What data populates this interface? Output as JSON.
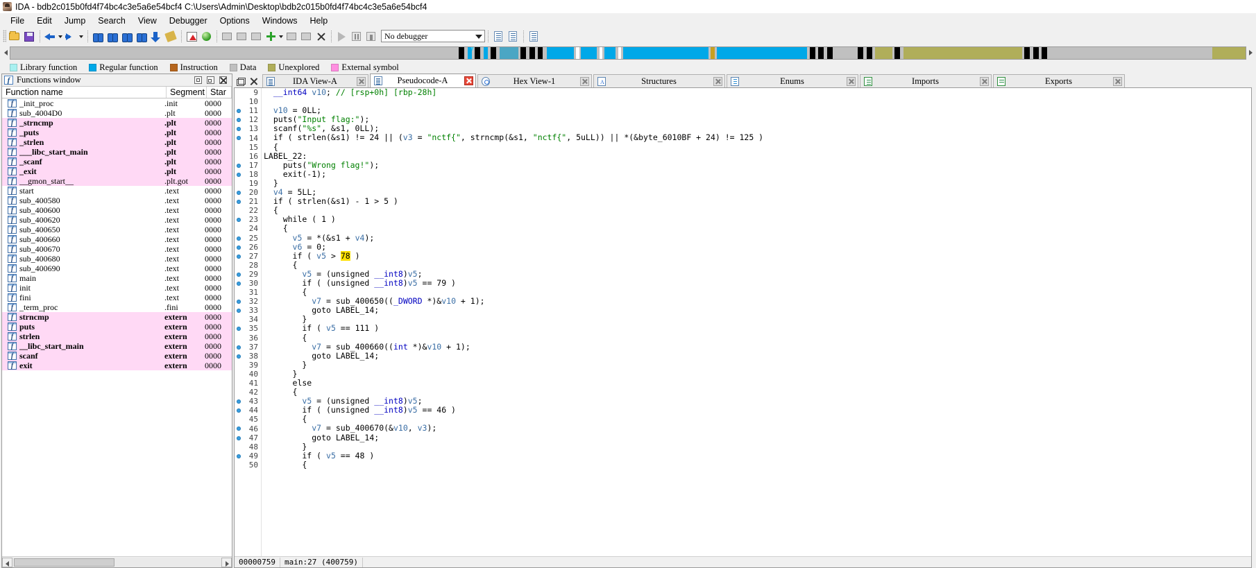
{
  "window": {
    "title": "IDA - bdb2c015b0fd4f74bc4c3e5a6e54bcf4 C:\\Users\\Admin\\Desktop\\bdb2c015b0fd4f74bc4c3e5a6e54bcf4",
    "icon": "ida-logo-icon"
  },
  "menu": {
    "items": [
      "File",
      "Edit",
      "Jump",
      "Search",
      "View",
      "Debugger",
      "Options",
      "Windows",
      "Help"
    ]
  },
  "toolbar": {
    "debugger_select_value": "No debugger",
    "icons": [
      "open-file-icon",
      "save-icon",
      "back-arrow-icon",
      "back-dropdown-icon",
      "forward-arrow-icon",
      "forward-dropdown-icon",
      "search-hash-icon",
      "search-text-icon",
      "search-immediate-icon",
      "search-next-icon",
      "jump-down-icon",
      "edit-function-icon",
      "graph-view-icon",
      "green-ball-icon",
      "make-code-icon",
      "make-data-icon",
      "make-string-icon",
      "add-function-icon",
      "add-function-dropdown-icon",
      "delete-function-icon",
      "undefine-icon",
      "delete-icon",
      "run-icon",
      "pause-icon",
      "stop-icon",
      "step-icon",
      "step-over-icon",
      "breakpoints-icon"
    ]
  },
  "navband": {
    "left_arrow": "nav-scroll-left-icon",
    "right_arrow": "nav-scroll-right-icon",
    "cursor_position_pct": 37.2,
    "segments": [
      {
        "left_pct": 0.0,
        "width_pct": 36.3,
        "color": "#c0c0c0"
      },
      {
        "left_pct": 36.3,
        "width_pct": 0.45,
        "color": "#000000"
      },
      {
        "left_pct": 37.0,
        "width_pct": 0.35,
        "color": "#00a8e8"
      },
      {
        "left_pct": 37.6,
        "width_pct": 0.45,
        "color": "#000000"
      },
      {
        "left_pct": 38.3,
        "width_pct": 0.35,
        "color": "#00a8e8"
      },
      {
        "left_pct": 38.9,
        "width_pct": 0.4,
        "color": "#000000"
      },
      {
        "left_pct": 39.6,
        "width_pct": 1.5,
        "color": "#4ba6c4"
      },
      {
        "left_pct": 41.3,
        "width_pct": 0.45,
        "color": "#000000"
      },
      {
        "left_pct": 42.0,
        "width_pct": 0.45,
        "color": "#000000"
      },
      {
        "left_pct": 42.7,
        "width_pct": 0.4,
        "color": "#000000"
      },
      {
        "left_pct": 43.4,
        "width_pct": 2.2,
        "color": "#00a8e8"
      },
      {
        "left_pct": 45.8,
        "width_pct": 0.25,
        "color": "#ffffff"
      },
      {
        "left_pct": 46.2,
        "width_pct": 1.3,
        "color": "#00a8e8"
      },
      {
        "left_pct": 47.7,
        "width_pct": 0.25,
        "color": "#ffffff"
      },
      {
        "left_pct": 48.1,
        "width_pct": 0.9,
        "color": "#00a8e8"
      },
      {
        "left_pct": 49.2,
        "width_pct": 0.25,
        "color": "#ffffff"
      },
      {
        "left_pct": 49.6,
        "width_pct": 6.9,
        "color": "#00a8e8"
      },
      {
        "left_pct": 56.7,
        "width_pct": 0.3,
        "color": "#c8a020"
      },
      {
        "left_pct": 57.2,
        "width_pct": 7.3,
        "color": "#00a8e8"
      },
      {
        "left_pct": 64.7,
        "width_pct": 0.45,
        "color": "#000000"
      },
      {
        "left_pct": 65.4,
        "width_pct": 0.45,
        "color": "#000000"
      },
      {
        "left_pct": 66.1,
        "width_pct": 0.45,
        "color": "#000000"
      },
      {
        "left_pct": 66.8,
        "width_pct": 1.6,
        "color": "#c0c0c0"
      },
      {
        "left_pct": 68.6,
        "width_pct": 0.45,
        "color": "#000000"
      },
      {
        "left_pct": 69.3,
        "width_pct": 0.45,
        "color": "#000000"
      },
      {
        "left_pct": 70.0,
        "width_pct": 1.4,
        "color": "#b0ae5a"
      },
      {
        "left_pct": 71.6,
        "width_pct": 0.45,
        "color": "#000000"
      },
      {
        "left_pct": 72.3,
        "width_pct": 9.6,
        "color": "#b0ae5a"
      },
      {
        "left_pct": 82.1,
        "width_pct": 0.45,
        "color": "#000000"
      },
      {
        "left_pct": 82.8,
        "width_pct": 0.45,
        "color": "#000000"
      },
      {
        "left_pct": 83.5,
        "width_pct": 0.45,
        "color": "#000000"
      },
      {
        "left_pct": 84.2,
        "width_pct": 12.9,
        "color": "#c0c0c0"
      },
      {
        "left_pct": 97.3,
        "width_pct": 2.7,
        "color": "#b0ae5a"
      }
    ]
  },
  "legend": {
    "items": [
      {
        "label": "Library function",
        "color": "#a8f0f0"
      },
      {
        "label": "Regular function",
        "color": "#00a8e8"
      },
      {
        "label": "Instruction",
        "color": "#b5651d"
      },
      {
        "label": "Data",
        "color": "#c0c0c0"
      },
      {
        "label": "Unexplored",
        "color": "#b0ae5a"
      },
      {
        "label": "External symbol",
        "color": "#ff8fe0"
      }
    ]
  },
  "functions_window": {
    "title": "Functions window",
    "title_icon": "function-f-icon",
    "window_buttons": [
      "dock-icon",
      "maximize-icon",
      "restore-icon",
      "close-icon"
    ],
    "columns": [
      "Function name",
      "Segment",
      "Star"
    ],
    "rows": [
      {
        "name": "_init_proc",
        "segment": ".init",
        "start": "0000",
        "pink": false,
        "bold": false
      },
      {
        "name": "sub_4004D0",
        "segment": ".plt",
        "start": "0000",
        "pink": false,
        "bold": false
      },
      {
        "name": "_strncmp",
        "segment": ".plt",
        "start": "0000",
        "pink": true,
        "bold": true
      },
      {
        "name": "_puts",
        "segment": ".plt",
        "start": "0000",
        "pink": true,
        "bold": true
      },
      {
        "name": "_strlen",
        "segment": ".plt",
        "start": "0000",
        "pink": true,
        "bold": true
      },
      {
        "name": "___libc_start_main",
        "segment": ".plt",
        "start": "0000",
        "pink": true,
        "bold": true
      },
      {
        "name": "_scanf",
        "segment": ".plt",
        "start": "0000",
        "pink": true,
        "bold": true
      },
      {
        "name": "_exit",
        "segment": ".plt",
        "start": "0000",
        "pink": true,
        "bold": true
      },
      {
        "name": "__gmon_start__",
        "segment": ".plt.got",
        "start": "0000",
        "pink": true,
        "bold": false
      },
      {
        "name": "start",
        "segment": ".text",
        "start": "0000",
        "pink": false,
        "bold": false
      },
      {
        "name": "sub_400580",
        "segment": ".text",
        "start": "0000",
        "pink": false,
        "bold": false
      },
      {
        "name": "sub_400600",
        "segment": ".text",
        "start": "0000",
        "pink": false,
        "bold": false
      },
      {
        "name": "sub_400620",
        "segment": ".text",
        "start": "0000",
        "pink": false,
        "bold": false
      },
      {
        "name": "sub_400650",
        "segment": ".text",
        "start": "0000",
        "pink": false,
        "bold": false
      },
      {
        "name": "sub_400660",
        "segment": ".text",
        "start": "0000",
        "pink": false,
        "bold": false
      },
      {
        "name": "sub_400670",
        "segment": ".text",
        "start": "0000",
        "pink": false,
        "bold": false
      },
      {
        "name": "sub_400680",
        "segment": ".text",
        "start": "0000",
        "pink": false,
        "bold": false
      },
      {
        "name": "sub_400690",
        "segment": ".text",
        "start": "0000",
        "pink": false,
        "bold": false
      },
      {
        "name": "main",
        "segment": ".text",
        "start": "0000",
        "pink": false,
        "bold": false
      },
      {
        "name": "init",
        "segment": ".text",
        "start": "0000",
        "pink": false,
        "bold": false
      },
      {
        "name": "fini",
        "segment": ".text",
        "start": "0000",
        "pink": false,
        "bold": false
      },
      {
        "name": "_term_proc",
        "segment": ".fini",
        "start": "0000",
        "pink": false,
        "bold": false
      },
      {
        "name": "strncmp",
        "segment": "extern",
        "start": "0000",
        "pink": true,
        "bold": true
      },
      {
        "name": "puts",
        "segment": "extern",
        "start": "0000",
        "pink": true,
        "bold": true
      },
      {
        "name": "strlen",
        "segment": "extern",
        "start": "0000",
        "pink": true,
        "bold": true
      },
      {
        "name": "__libc_start_main",
        "segment": "extern",
        "start": "0000",
        "pink": true,
        "bold": true
      },
      {
        "name": "scanf",
        "segment": "extern",
        "start": "0000",
        "pink": true,
        "bold": true
      },
      {
        "name": "exit",
        "segment": "extern",
        "start": "0000",
        "pink": true,
        "bold": true
      }
    ]
  },
  "tabs": [
    {
      "label": "IDA View-A",
      "icon": "ida-view-icon",
      "active": false
    },
    {
      "label": "Pseudocode-A",
      "icon": "pseudocode-icon",
      "active": true
    },
    {
      "label": "Hex View-1",
      "icon": "hex-view-icon",
      "active": false
    },
    {
      "label": "Structures",
      "icon": "structures-icon",
      "active": false
    },
    {
      "label": "Enums",
      "icon": "enums-icon",
      "active": false
    },
    {
      "label": "Imports",
      "icon": "imports-icon",
      "active": false
    },
    {
      "label": "Exports",
      "icon": "exports-icon",
      "active": false
    }
  ],
  "pseudocode": {
    "first_line_number": 9,
    "lines": [
      {
        "n": 9,
        "dot": false,
        "indent": 2,
        "html": "<span class=\"k\">__int64</span> <span class=\"var\">v10</span>; <span class=\"cmt\">// [rsp+0h] [rbp-28h]</span>"
      },
      {
        "n": 10,
        "dot": false,
        "indent": 0,
        "html": ""
      },
      {
        "n": 11,
        "dot": true,
        "indent": 2,
        "html": "<span class=\"var\">v10</span> = 0LL;"
      },
      {
        "n": 12,
        "dot": true,
        "indent": 2,
        "html": "puts(<span class=\"str\">\"Input flag:\"</span>);"
      },
      {
        "n": 13,
        "dot": true,
        "indent": 2,
        "html": "scanf(<span class=\"str\">\"%s\"</span>, &amp;s1, 0LL);"
      },
      {
        "n": 14,
        "dot": true,
        "indent": 2,
        "html": "if ( strlen(&amp;s1) != 24 || (<span class=\"var\">v3</span> = <span class=\"str\">\"nctf{\"</span>, strncmp(&amp;s1, <span class=\"str\">\"nctf{\"</span>, 5uLL)) || *(&amp;byte_6010BF + 24) != 125 )"
      },
      {
        "n": 15,
        "dot": false,
        "indent": 2,
        "html": "{"
      },
      {
        "n": 16,
        "dot": false,
        "indent": 0,
        "html": "LABEL_22:"
      },
      {
        "n": 17,
        "dot": true,
        "indent": 4,
        "html": "puts(<span class=\"str\">\"Wrong flag!\"</span>);"
      },
      {
        "n": 18,
        "dot": true,
        "indent": 4,
        "html": "exit(-1);"
      },
      {
        "n": 19,
        "dot": false,
        "indent": 2,
        "html": "}"
      },
      {
        "n": 20,
        "dot": true,
        "indent": 2,
        "html": "<span class=\"var\">v4</span> = 5LL;"
      },
      {
        "n": 21,
        "dot": true,
        "indent": 2,
        "html": "if ( strlen(&amp;s1) - 1 &gt; 5 )"
      },
      {
        "n": 22,
        "dot": false,
        "indent": 2,
        "html": "{"
      },
      {
        "n": 23,
        "dot": true,
        "indent": 4,
        "html": "while ( 1 )"
      },
      {
        "n": 24,
        "dot": false,
        "indent": 4,
        "html": "{"
      },
      {
        "n": 25,
        "dot": true,
        "indent": 6,
        "html": "<span class=\"var\">v5</span> = *(&amp;s1 + <span class=\"var\">v4</span>);"
      },
      {
        "n": 26,
        "dot": true,
        "indent": 6,
        "html": "<span class=\"var\">v6</span> = 0;"
      },
      {
        "n": 27,
        "dot": true,
        "indent": 6,
        "html": "if ( <span class=\"var\">v5</span> &gt; <span class=\"hl\">78</span> )"
      },
      {
        "n": 28,
        "dot": false,
        "indent": 6,
        "html": "{"
      },
      {
        "n": 29,
        "dot": true,
        "indent": 8,
        "html": "<span class=\"var\">v5</span> = (unsigned <span class=\"k\">__int8</span>)<span class=\"var\">v5</span>;"
      },
      {
        "n": 30,
        "dot": true,
        "indent": 8,
        "html": "if ( (unsigned <span class=\"k\">__int8</span>)<span class=\"var\">v5</span> == 79 )"
      },
      {
        "n": 31,
        "dot": false,
        "indent": 8,
        "html": "{"
      },
      {
        "n": 32,
        "dot": true,
        "indent": 10,
        "html": "<span class=\"var\">v7</span> = sub_400650((<span class=\"k\">_DWORD</span> *)&amp;<span class=\"var\">v10</span> + 1);"
      },
      {
        "n": 33,
        "dot": true,
        "indent": 10,
        "html": "goto LABEL_14;"
      },
      {
        "n": 34,
        "dot": false,
        "indent": 8,
        "html": "}"
      },
      {
        "n": 35,
        "dot": true,
        "indent": 8,
        "html": "if ( <span class=\"var\">v5</span> == 111 )"
      },
      {
        "n": 36,
        "dot": false,
        "indent": 8,
        "html": "{"
      },
      {
        "n": 37,
        "dot": true,
        "indent": 10,
        "html": "<span class=\"var\">v7</span> = sub_400660((<span class=\"k\">int</span> *)&amp;<span class=\"var\">v10</span> + 1);"
      },
      {
        "n": 38,
        "dot": true,
        "indent": 10,
        "html": "goto LABEL_14;"
      },
      {
        "n": 39,
        "dot": false,
        "indent": 8,
        "html": "}"
      },
      {
        "n": 40,
        "dot": false,
        "indent": 6,
        "html": "}"
      },
      {
        "n": 41,
        "dot": false,
        "indent": 6,
        "html": "else"
      },
      {
        "n": 42,
        "dot": false,
        "indent": 6,
        "html": "{"
      },
      {
        "n": 43,
        "dot": true,
        "indent": 8,
        "html": "<span class=\"var\">v5</span> = (unsigned <span class=\"k\">__int8</span>)<span class=\"var\">v5</span>;"
      },
      {
        "n": 44,
        "dot": true,
        "indent": 8,
        "html": "if ( (unsigned <span class=\"k\">__int8</span>)<span class=\"var\">v5</span> == 46 )"
      },
      {
        "n": 45,
        "dot": false,
        "indent": 8,
        "html": "{"
      },
      {
        "n": 46,
        "dot": true,
        "indent": 10,
        "html": "<span class=\"var\">v7</span> = sub_400670(&amp;<span class=\"var\">v10</span>, <span class=\"var\">v3</span>);"
      },
      {
        "n": 47,
        "dot": true,
        "indent": 10,
        "html": "goto LABEL_14;"
      },
      {
        "n": 48,
        "dot": false,
        "indent": 8,
        "html": "}"
      },
      {
        "n": 49,
        "dot": true,
        "indent": 8,
        "html": "if ( <span class=\"var\">v5</span> == 48 )"
      },
      {
        "n": 50,
        "dot": false,
        "indent": 8,
        "html": "{"
      }
    ]
  },
  "statusbar": {
    "address": "00000759",
    "location": "main:27 (400759)"
  }
}
